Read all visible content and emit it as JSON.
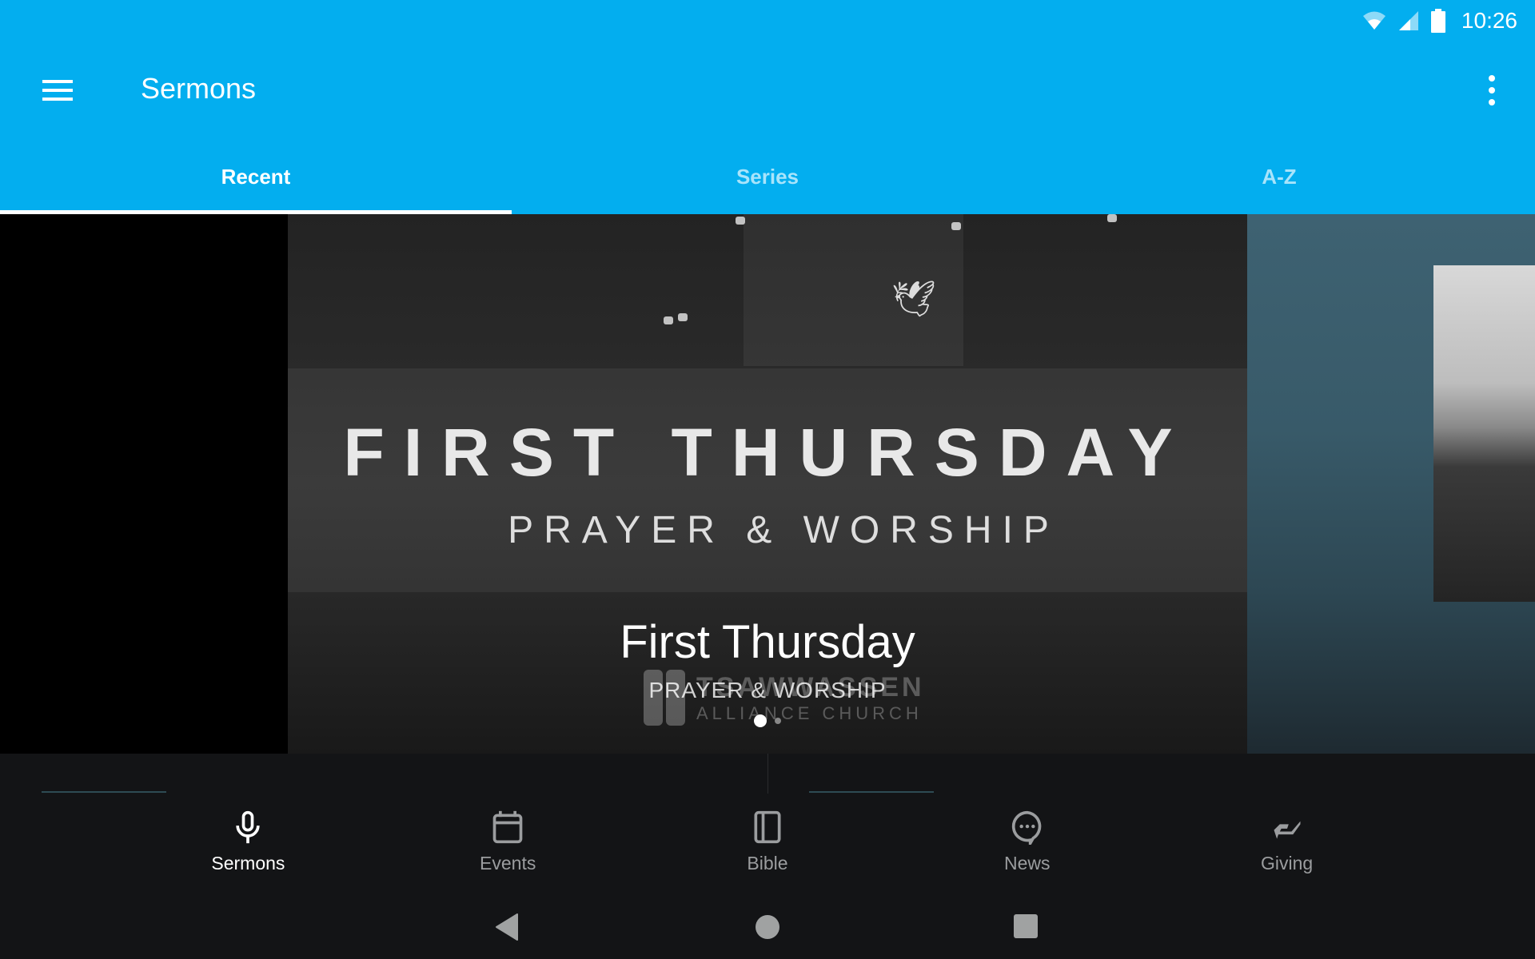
{
  "status_bar": {
    "time": "10:26",
    "icons": [
      "wifi-icon",
      "cell-signal-icon",
      "battery-icon"
    ]
  },
  "app_bar": {
    "title": "Sermons",
    "menu_icon": "hamburger-menu-icon",
    "overflow_icon": "more-vert-icon",
    "color": "#03AEEF"
  },
  "tabs": [
    {
      "label": "Recent",
      "active": true
    },
    {
      "label": "Series",
      "active": false
    },
    {
      "label": "A-Z",
      "active": false
    }
  ],
  "carousel": {
    "current": {
      "poster_title": "FIRST THURSDAY",
      "poster_subtitle": "PRAYER & WORSHIP",
      "logo_line1": "TSAWWASSEN",
      "logo_line2": "ALLIANCE CHURCH",
      "title": "First Thursday",
      "subtitle": "PRAYER & WORSHIP"
    },
    "page_count": 2,
    "current_page": 1
  },
  "bottom_nav": [
    {
      "label": "Sermons",
      "icon": "microphone-icon",
      "active": true
    },
    {
      "label": "Events",
      "icon": "calendar-icon",
      "active": false
    },
    {
      "label": "Bible",
      "icon": "book-icon",
      "active": false
    },
    {
      "label": "News",
      "icon": "chat-bubble-icon",
      "active": false
    },
    {
      "label": "Giving",
      "icon": "giving-hand-icon",
      "active": false
    }
  ],
  "system_nav": [
    "back-icon",
    "home-icon",
    "recents-icon"
  ]
}
